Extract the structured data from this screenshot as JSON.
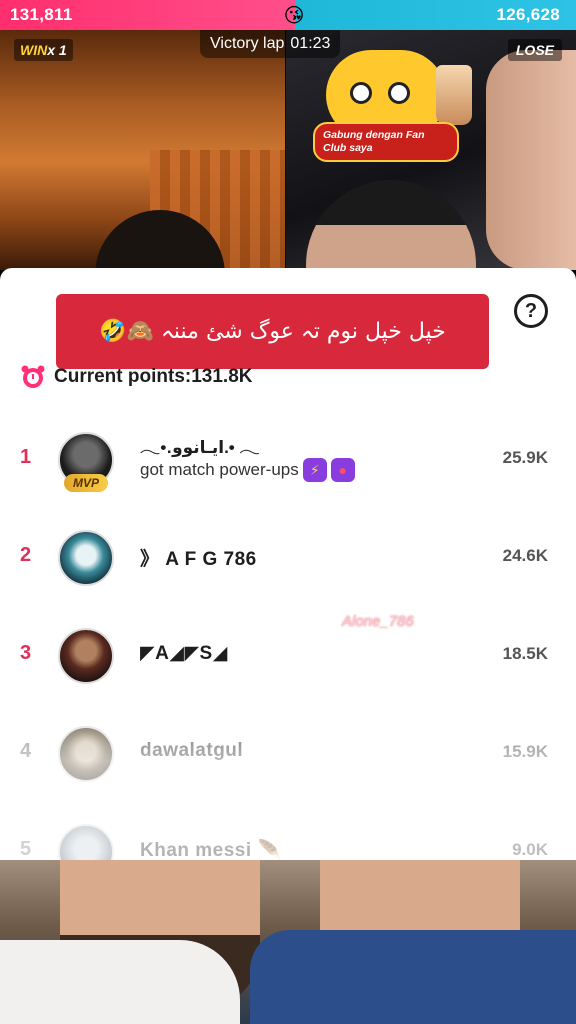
{
  "battle": {
    "left_score": "131,811",
    "right_score": "126,628",
    "divider_emoji": "😘",
    "win_word": "WIN",
    "win_count": "x 1",
    "lose_label": "LOSE",
    "victory_label": "Victory lap",
    "timer": "01:23",
    "fan_club_label": "Gabung dengan Fan Club saya"
  },
  "sheet": {
    "banner_text": "خپل خپل نوم تہ عوگ شئ مننہ 🙈🤣",
    "help_glyph": "?",
    "points_label": "Current points:131.8K"
  },
  "ranks": [
    {
      "rank": "1",
      "name": "•.ایـانوو.• ",
      "subtitle": "got match power-ups",
      "score": "25.9K",
      "badge": "MVP"
    },
    {
      "rank": "2",
      "name": "》 A F G 786",
      "score": "24.6K"
    },
    {
      "rank": "3",
      "name": "◤A◢◤S◢",
      "score": "18.5K"
    },
    {
      "rank": "4",
      "name": "dawalatgul",
      "score": "15.9K"
    },
    {
      "rank": "5",
      "name": "Khan messi",
      "score": "9.0K"
    }
  ],
  "watermark": "Alone_786",
  "colors": {
    "pink": "#ff2e6e",
    "cyan": "#1fb8d8",
    "banner_red": "#d8283c",
    "rank_pink": "#e0305a"
  },
  "icons": [
    "emoji-kiss-icon",
    "help-circle-icon",
    "alarm-clock-icon",
    "lightning-icon",
    "rocket-icon",
    "feather-icon"
  ]
}
